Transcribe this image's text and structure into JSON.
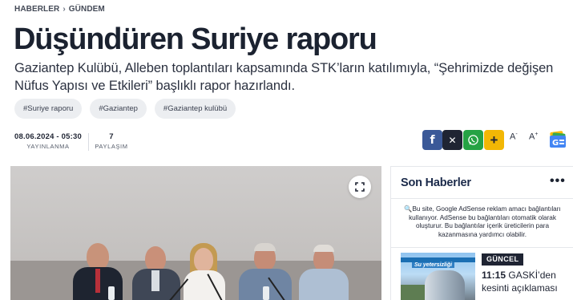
{
  "breadcrumb": {
    "items": [
      "HABERLER",
      "GÜNDEM"
    ],
    "separator": "›"
  },
  "article": {
    "title": "Düşündüren Suriye raporu",
    "summary": "Gaziantep Kulübü, Alleben toplantıları kapsamında STK’ların katılımıyla, “Şehrimizde değişen Nüfus Yapısı ve Etkileri” başlıklı rapor hazırlandı.",
    "tags": [
      "#Suriye raporu",
      "#Gaziantep",
      "#Gaziantep kulübü"
    ],
    "published": {
      "value": "08.06.2024 - 05:30",
      "label": "YAYINLANMA"
    },
    "shares": {
      "value": "7",
      "label": "PAYLAŞIM"
    }
  },
  "share_buttons": {
    "facebook": {
      "glyph": "f",
      "color": "#3b5998"
    },
    "x": {
      "glyph": "𝕏",
      "color": "#1f2433"
    },
    "whatsapp": {
      "glyph": "✆",
      "color": "#25a244"
    },
    "more": {
      "glyph": "+",
      "color": "#f2b705"
    }
  },
  "font_size_controls": {
    "decrease": "A",
    "decrease_sup": "-",
    "increase": "A",
    "increase_sup": "+"
  },
  "google_news_badge": "G",
  "hero": {
    "expand_icon": "expand-icon"
  },
  "sidebar": {
    "title": "Son Haberler",
    "more": "•••",
    "notice": "🔍Bu site, Google AdSense reklam amacı bağlantıları kullanıyor. AdSense bu bağlantıları otomatik olarak oluşturur. Bu bağlantılar içerik üreticilerin para kazanmasına yardımcı olabilir.",
    "news": [
      {
        "category": "GÜNCEL",
        "time": "11:15",
        "headline": "GASKİ’den kesinti açıklaması",
        "thumb_caption": "Su yetersizliği"
      }
    ]
  }
}
